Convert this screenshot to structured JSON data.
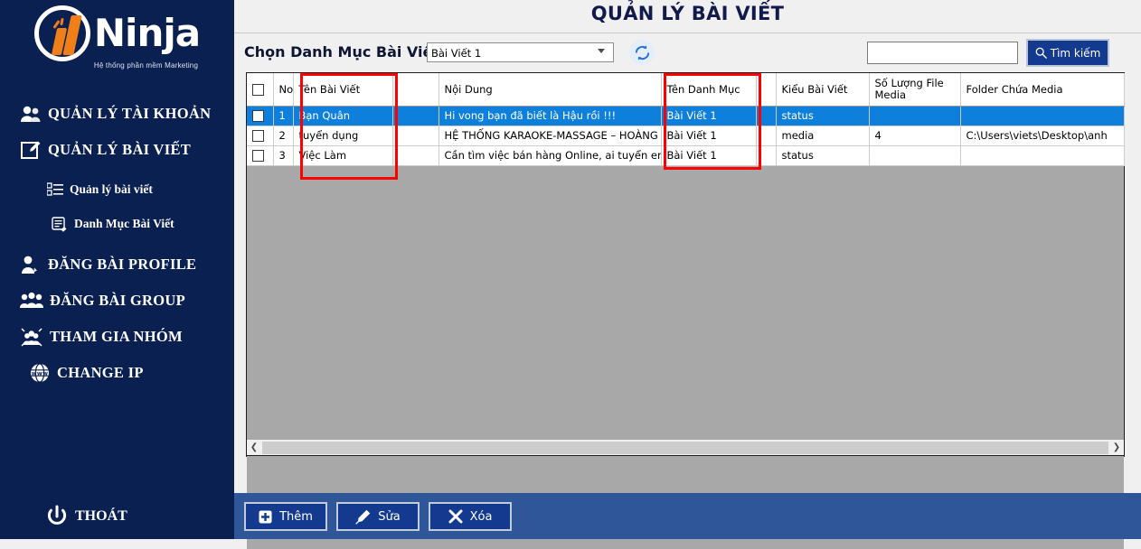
{
  "app": {
    "logo_text": "Ninja",
    "logo_tagline": "Hệ thống phần mềm Marketing"
  },
  "sidebar": {
    "items": [
      {
        "label": "QUẢN LÝ TÀI KHOẢN",
        "icon": "users-icon",
        "level": "main"
      },
      {
        "label": "QUẢN LÝ BÀI VIẾT",
        "icon": "edit-square-icon",
        "level": "main"
      },
      {
        "label": "Quản lý bài viết",
        "icon": "list-icon",
        "level": "sub"
      },
      {
        "label": "Danh Mục Bài Viết",
        "icon": "document-edit-icon",
        "level": "sub"
      },
      {
        "label": "ĐĂNG BÀI PROFILE",
        "icon": "user-pencil-icon",
        "level": "main"
      },
      {
        "label": "ĐĂNG BÀI GROUP",
        "icon": "group-icon",
        "level": "main"
      },
      {
        "label": "THAM GIA NHÓM",
        "icon": "join-group-icon",
        "level": "main"
      },
      {
        "label": "CHANGE IP",
        "icon": "globe-www-icon",
        "level": "main"
      }
    ],
    "exit": {
      "label": "THOÁT",
      "icon": "power-icon"
    }
  },
  "header": {
    "title": "QUẢN LÝ BÀI VIẾT"
  },
  "toolbar": {
    "category_label": "Chọn Danh Mục Bài Viết",
    "category_selected": "Bài Viết 1",
    "category_options": [
      "Bài Viết 1"
    ],
    "refresh_icon": "refresh-icon",
    "search_value": "",
    "search_placeholder": "",
    "search_button_label": "Tìm kiếm",
    "search_icon": "search-icon"
  },
  "grid": {
    "columns": [
      {
        "key": "check",
        "label": ""
      },
      {
        "key": "no",
        "label": "No"
      },
      {
        "key": "ten_bai_viet",
        "label": "Tên Bài Viết"
      },
      {
        "key": "blank1",
        "label": ""
      },
      {
        "key": "noi_dung",
        "label": "Nội Dung"
      },
      {
        "key": "ten_danh_muc",
        "label": "Tên Danh Mục"
      },
      {
        "key": "blank2",
        "label": ""
      },
      {
        "key": "kieu_bai_viet",
        "label": "Kiểu Bài Viết"
      },
      {
        "key": "so_luong_file_media",
        "label": "Số Lượng File Media"
      },
      {
        "key": "folder_chua_media",
        "label": "Folder Chứa Media"
      }
    ],
    "rows": [
      {
        "selected": true,
        "no": "1",
        "ten_bai_viet": "Bạn Quân",
        "blank1": "",
        "noi_dung": "Hi vong bạn đã biết là Hậu rồi !!!",
        "ten_danh_muc": "Bài Viết 1",
        "blank2": "",
        "kieu_bai_viet": "status",
        "so_luong_file_media": "",
        "folder_chua_media": ""
      },
      {
        "selected": false,
        "no": "2",
        "ten_bai_viet": "tuyển dụng",
        "blank1": "",
        "noi_dung": "HỆ THỐNG KARAOKE-MASSAGE – HOÀNG GI...",
        "ten_danh_muc": "Bài Viết 1",
        "blank2": "",
        "kieu_bai_viet": "media",
        "so_luong_file_media": "4",
        "folder_chua_media": "C:\\Users\\viets\\Desktop\\anh"
      },
      {
        "selected": false,
        "no": "3",
        "ten_bai_viet": "Việc Làm",
        "blank1": "",
        "noi_dung": "Cần tìm việc bán hàng Online, ai tuyển em không...",
        "ten_danh_muc": "Bài Viết 1",
        "blank2": "",
        "kieu_bai_viet": "status",
        "so_luong_file_media": "",
        "folder_chua_media": ""
      }
    ],
    "scroll_left_icon": "chevron-left-icon",
    "scroll_right_icon": "chevron-right-icon"
  },
  "actions": {
    "add_label": "Thêm",
    "add_icon": "plus-square-icon",
    "edit_label": "Sửa",
    "edit_icon": "pencil-icon",
    "delete_label": "Xóa",
    "delete_icon": "x-icon"
  },
  "colors": {
    "sidebar_bg": "#0a2050",
    "accent_blue": "#133a8f",
    "action_bar_bg": "#2e5699",
    "selected_row": "#0f7fdc",
    "annotation_red": "#ff0000",
    "logo_orange": "#f07f1a",
    "grid_empty": "#a8a8a8"
  }
}
